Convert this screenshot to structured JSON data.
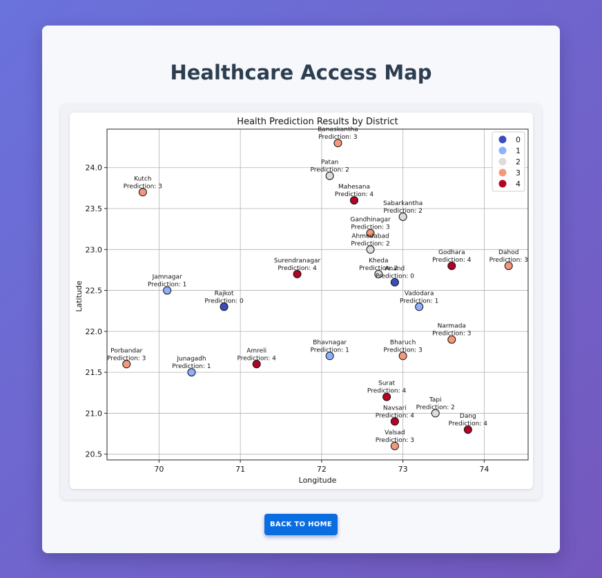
{
  "page": {
    "title": "Healthcare Access Map",
    "back_button": "BACK TO HOME"
  },
  "chart_data": {
    "type": "scatter",
    "title": "Health Prediction Results by District",
    "xlabel": "Longitude",
    "ylabel": "Latitude",
    "xlim": [
      69.36,
      74.54
    ],
    "ylim": [
      20.43,
      24.47
    ],
    "xticks": [
      70,
      71,
      72,
      73,
      74
    ],
    "yticks": [
      20.5,
      21.0,
      21.5,
      22.0,
      22.5,
      23.0,
      23.5,
      24.0
    ],
    "grid": true,
    "legend_position": "upper right",
    "label_prefix": "Prediction: ",
    "classes": [
      {
        "label": "0",
        "color": "#3b4cc0"
      },
      {
        "label": "1",
        "color": "#8db0fe"
      },
      {
        "label": "2",
        "color": "#dddcdc"
      },
      {
        "label": "3",
        "color": "#f4987a"
      },
      {
        "label": "4",
        "color": "#b40426"
      }
    ],
    "points": [
      {
        "name": "Banaskantha",
        "x": 72.2,
        "y": 24.3,
        "prediction": 3
      },
      {
        "name": "Patan",
        "x": 72.1,
        "y": 23.9,
        "prediction": 2
      },
      {
        "name": "Kutch",
        "x": 69.8,
        "y": 23.7,
        "prediction": 3
      },
      {
        "name": "Mahesana",
        "x": 72.4,
        "y": 23.6,
        "prediction": 4
      },
      {
        "name": "Sabarkantha",
        "x": 73.0,
        "y": 23.4,
        "prediction": 2
      },
      {
        "name": "Gandhinagar",
        "x": 72.6,
        "y": 23.2,
        "prediction": 3
      },
      {
        "name": "Ahmedabad",
        "x": 72.6,
        "y": 23.0,
        "prediction": 2
      },
      {
        "name": "Godhara",
        "x": 73.6,
        "y": 22.8,
        "prediction": 4
      },
      {
        "name": "Dahod",
        "x": 74.3,
        "y": 22.8,
        "prediction": 3
      },
      {
        "name": "Surendranagar",
        "x": 71.7,
        "y": 22.7,
        "prediction": 4
      },
      {
        "name": "Kheda",
        "x": 72.7,
        "y": 22.7,
        "prediction": 2
      },
      {
        "name": "Anand",
        "x": 72.9,
        "y": 22.6,
        "prediction": 0
      },
      {
        "name": "Jamnagar",
        "x": 70.1,
        "y": 22.5,
        "prediction": 1
      },
      {
        "name": "Rajkot",
        "x": 70.8,
        "y": 22.3,
        "prediction": 0
      },
      {
        "name": "Vadodara",
        "x": 73.2,
        "y": 22.3,
        "prediction": 1
      },
      {
        "name": "Narmada",
        "x": 73.6,
        "y": 21.9,
        "prediction": 3
      },
      {
        "name": "Bhavnagar",
        "x": 72.1,
        "y": 21.7,
        "prediction": 1
      },
      {
        "name": "Bharuch",
        "x": 73.0,
        "y": 21.7,
        "prediction": 3
      },
      {
        "name": "Porbandar",
        "x": 69.6,
        "y": 21.6,
        "prediction": 3
      },
      {
        "name": "Amreli",
        "x": 71.2,
        "y": 21.6,
        "prediction": 4
      },
      {
        "name": "Junagadh",
        "x": 70.4,
        "y": 21.5,
        "prediction": 1
      },
      {
        "name": "Surat",
        "x": 72.8,
        "y": 21.2,
        "prediction": 4
      },
      {
        "name": "Tapi",
        "x": 73.4,
        "y": 21.0,
        "prediction": 2
      },
      {
        "name": "Navsari",
        "x": 72.9,
        "y": 20.9,
        "prediction": 4
      },
      {
        "name": "Dang",
        "x": 73.8,
        "y": 20.8,
        "prediction": 4
      },
      {
        "name": "Valsad",
        "x": 72.9,
        "y": 20.6,
        "prediction": 3
      }
    ]
  }
}
